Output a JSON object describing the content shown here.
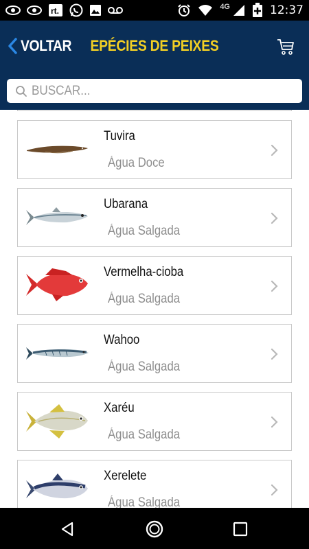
{
  "status_bar": {
    "time": "12:37",
    "network": "4G",
    "left_icons": [
      "eye-icon",
      "eye-icon",
      "rt-app-icon",
      "whatsapp-icon",
      "gallery-icon",
      "voicemail-icon"
    ],
    "right_icons": [
      "alarm-icon",
      "wifi-icon",
      "signal-icon",
      "battery-charging-icon"
    ]
  },
  "header": {
    "back_label": "VOLTAR",
    "title": "EPÉCIES DE PEIXES",
    "cart_icon": "cart-icon"
  },
  "search": {
    "placeholder": "BUSCAR...",
    "value": ""
  },
  "colors": {
    "header_bg": "#0a2e57",
    "title": "#f2cf24",
    "back_chevron": "#2a87e4"
  },
  "fish_list": [
    {
      "name": "Tuvira",
      "type": "Água Doce",
      "image": "tuvira-fish-image"
    },
    {
      "name": "Ubarana",
      "type": "Água Salgada",
      "image": "ubarana-fish-image"
    },
    {
      "name": "Vermelha-cioba",
      "type": "Água Salgada",
      "image": "vermelha-cioba-fish-image"
    },
    {
      "name": "Wahoo",
      "type": "Água Salgada",
      "image": "wahoo-fish-image"
    },
    {
      "name": "Xaréu",
      "type": "Água Salgada",
      "image": "xareu-fish-image"
    },
    {
      "name": "Xerelete",
      "type": "Água Salgada",
      "image": "xerelete-fish-image"
    }
  ],
  "nav_bar": [
    "back-nav-icon",
    "home-nav-icon",
    "recents-nav-icon"
  ]
}
